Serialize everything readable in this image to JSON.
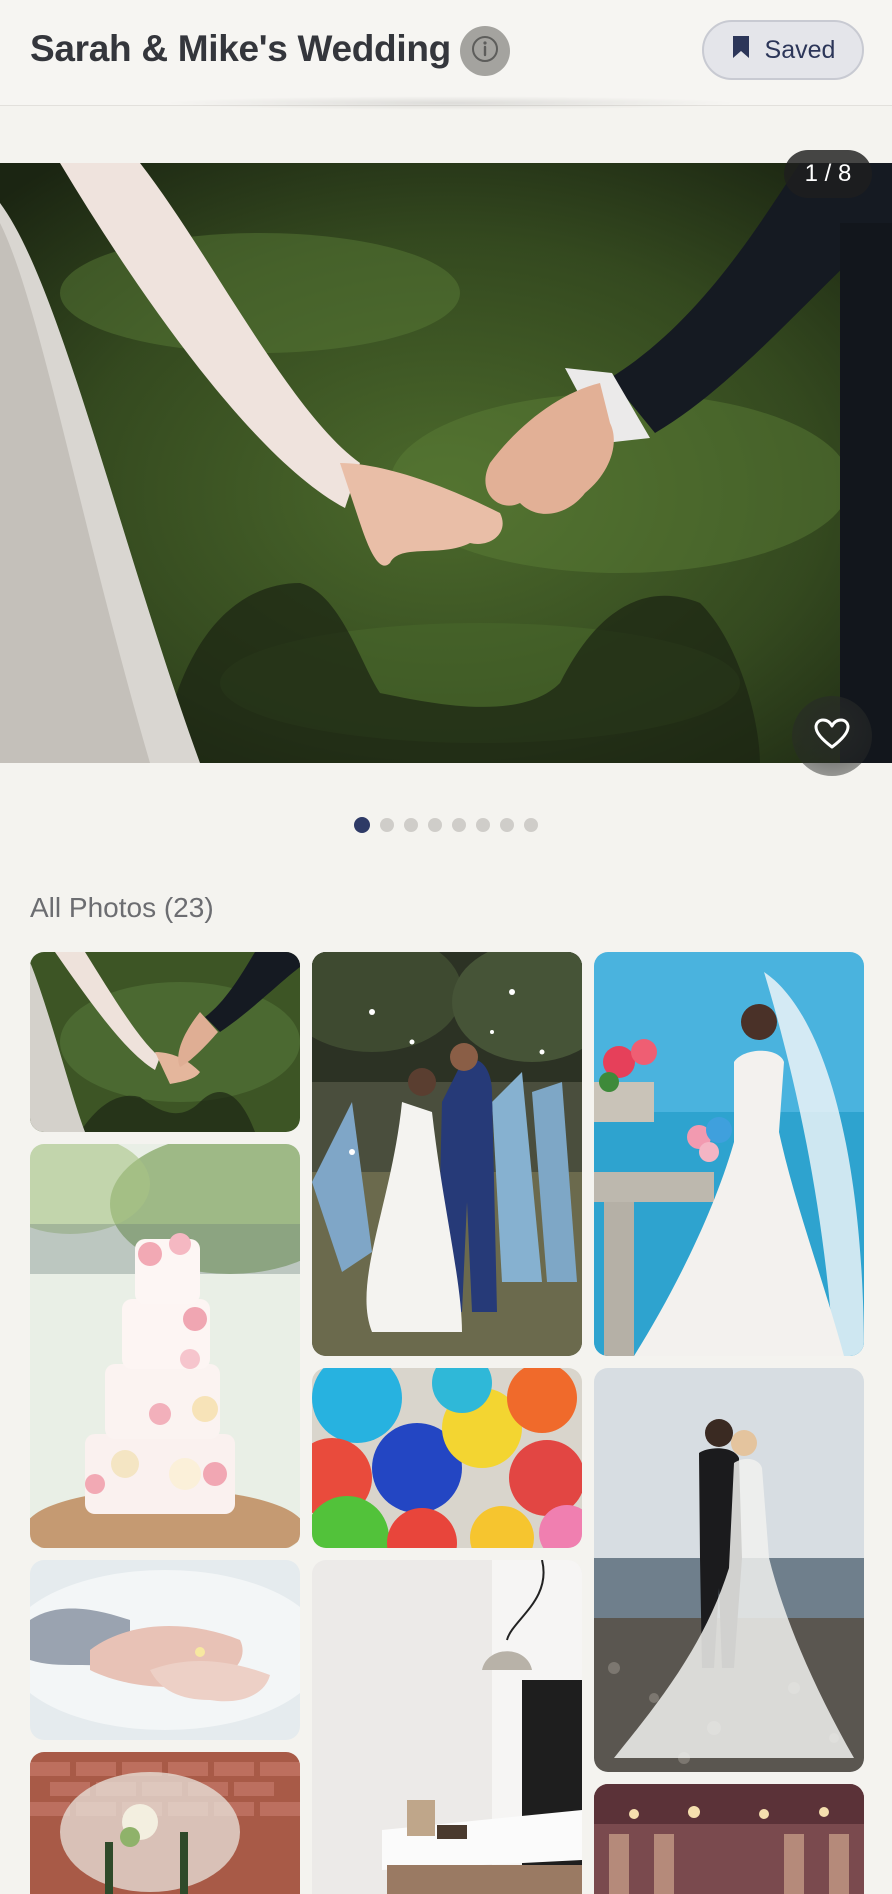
{
  "header": {
    "title": "Sarah & Mike's Wedding",
    "info_icon": "info-icon",
    "saved_label": "Saved",
    "saved_icon": "bookmark-icon"
  },
  "hero": {
    "counter": "1 / 8",
    "current_index": 1,
    "total": 8,
    "favorite_icon": "heart-outline-icon"
  },
  "carousel": {
    "dot_count": 8,
    "active_dot": 1
  },
  "gallery": {
    "title": "All Photos (23)",
    "photos": [
      "hands-holding",
      "couple-kiss-petals",
      "bride-by-sea",
      "wedding-cake",
      "balloons",
      "couple-on-beach",
      "ring-hands",
      "interior-lamp",
      "table-decor",
      "ballroom"
    ]
  },
  "colors": {
    "accent": "#2e3a66",
    "background": "#f4f3ef",
    "saved_bg": "#e4e5ea"
  }
}
